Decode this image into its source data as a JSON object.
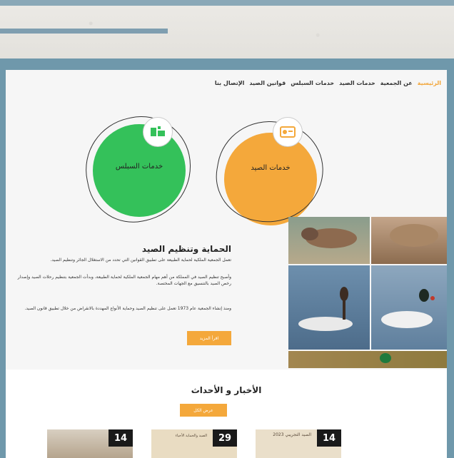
{
  "nav": {
    "items": [
      "الرئيسية",
      "عن الجمعية",
      "خدمات الصيد",
      "خدمات السبلس",
      "قوانين الصيد",
      "الإتصال بنا"
    ],
    "active_index": 0
  },
  "services": [
    {
      "label": "خدمات السبلس",
      "icon": "leaf-icon"
    },
    {
      "label": "خدمات الصيد",
      "icon": "card-icon"
    }
  ],
  "protection": {
    "title": "الحماية وتنظيم الصيد",
    "paragraphs": [
      "تعمل الجمعية الملكية لحماية الطبيعة على تطبيق القوانين التي تحدد من الاستغلال الجائر وتنظيم الصيد.",
      "وأصبح تنظيم الصيد في المملكة من أهم مهام الجمعية الملكية لحماية الطبيعة، وبدأت الجمعية بتنظيم رحلات الصيد وإصدار رخص الصيد بالتنسيق مع الجهات المختصة.",
      "ومنذ إنشاء الجمعية عام 1973 تعمل على تنظيم الصيد وحماية الأنواع المهددة بالانقراض من خلال تطبيق قانون الصيد."
    ],
    "button": "اقرأ المزيد"
  },
  "news": {
    "title": "الأخبار و الأحداث",
    "button": "عرض الكل",
    "cards": [
      {
        "day": "14",
        "text": ""
      },
      {
        "day": "29",
        "text": "الصيد والحماية الأحياء"
      },
      {
        "day": "14",
        "text": "الصيد التجريبي 2023"
      }
    ]
  },
  "colors": {
    "accent": "#f4a83b",
    "green": "#34c15a",
    "frame": "#6f98ab"
  }
}
